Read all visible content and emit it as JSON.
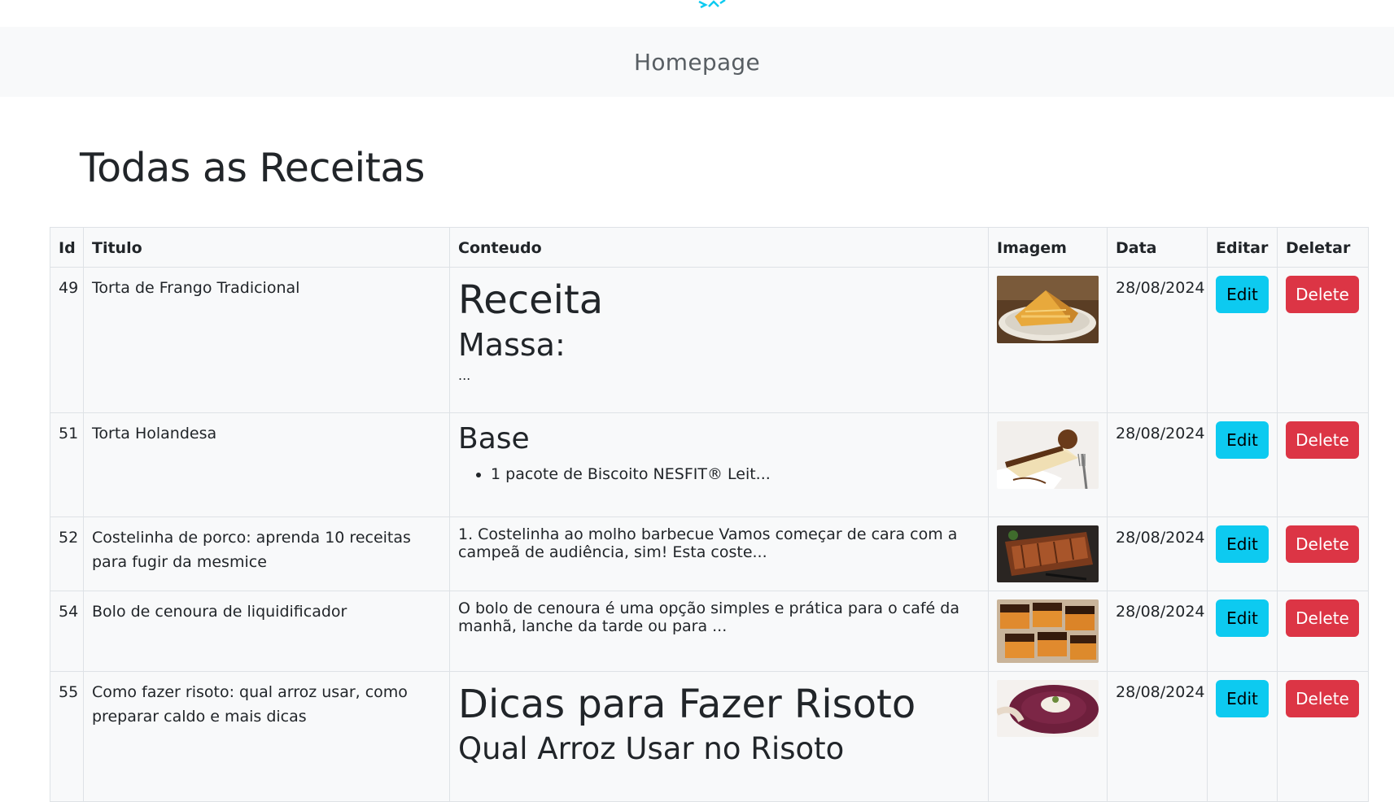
{
  "navbar": {
    "home_link": "Homepage"
  },
  "page": {
    "title": "Todas as Receitas"
  },
  "table": {
    "headers": [
      "Id",
      "Titulo",
      "Conteudo",
      "Imagem",
      "Data",
      "Editar",
      "Deletar"
    ],
    "edit_label": "Edit",
    "delete_label": "Delete",
    "rows": [
      {
        "id": "49",
        "title": "Torta de Frango Tradicional",
        "content_h1": "Receita",
        "content_h2": "Massa:",
        "content_text": "...",
        "date": "28/08/2024"
      },
      {
        "id": "51",
        "title": "Torta Holandesa",
        "content_h2": "Base",
        "content_item": "1 pacote de Biscoito NESFIT® Leit...",
        "date": "28/08/2024"
      },
      {
        "id": "52",
        "title": "Costelinha de porco: aprenda 10 receitas para fugir da mesmice",
        "content_text": "1. Costelinha ao molho barbecue Vamos começar de cara com a campeã de audiência, sim! Esta coste...",
        "date": "28/08/2024"
      },
      {
        "id": "54",
        "title": "Bolo de cenoura de liquidificador",
        "content_text": "O bolo de cenoura é uma opção simples e prática para o café da manhã, lanche da tarde ou para ...",
        "date": "28/08/2024"
      },
      {
        "id": "55",
        "title": "Como fazer risoto: qual arroz usar, como preparar caldo e mais dicas",
        "content_h1": "Dicas para Fazer Risoto",
        "content_h2": "Qual Arroz Usar no Risoto",
        "date": "28/08/2024"
      }
    ]
  },
  "colors": {
    "edit_button": "#0dcaf0",
    "delete_button": "#dc3545",
    "navbar_bg": "#f8f9fa",
    "logo": "#0dcaf0"
  }
}
